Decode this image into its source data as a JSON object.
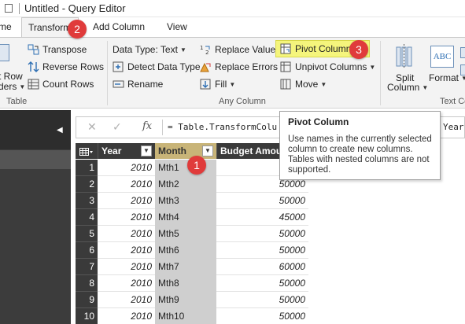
{
  "window": {
    "title": "Untitled - Query Editor"
  },
  "tabs": [
    {
      "label": "me"
    },
    {
      "label": "Transform"
    },
    {
      "label": "Add Column"
    },
    {
      "label": "View"
    }
  ],
  "ribbon": {
    "table_group": {
      "row_line1": "t Row",
      "row_line2": "ders",
      "transpose": "Transpose",
      "reverse_rows": "Reverse Rows",
      "count_rows": "Count Rows",
      "label": "Table"
    },
    "any_column_group": {
      "data_type": "Data Type: Text",
      "detect_data_type": "Detect Data Type",
      "rename": "Rename",
      "replace_values": "Replace Values",
      "replace_errors": "Replace Errors",
      "fill": "Fill",
      "pivot_column": "Pivot Column",
      "unpivot_columns": "Unpivot Columns",
      "move": "Move",
      "label": "Any Column"
    },
    "text_column_group": {
      "split_line1": "Split",
      "split_line2": "Column",
      "format": "Format",
      "abc_icon": "ABC",
      "label": "Text Co"
    }
  },
  "formula_bar": {
    "cancel": "✕",
    "confirm": "✓",
    "fx": "fx",
    "formula": "= Table.TransformColu",
    "formula_tail": "Year\""
  },
  "grid": {
    "columns": [
      "Year",
      "Month",
      "Budget Amount"
    ],
    "rows": [
      {
        "idx": "1",
        "year": "2010",
        "month": "Mth1",
        "amt": ""
      },
      {
        "idx": "2",
        "year": "2010",
        "month": "Mth2",
        "amt": "50000"
      },
      {
        "idx": "3",
        "year": "2010",
        "month": "Mth3",
        "amt": "50000"
      },
      {
        "idx": "4",
        "year": "2010",
        "month": "Mth4",
        "amt": "45000"
      },
      {
        "idx": "5",
        "year": "2010",
        "month": "Mth5",
        "amt": "50000"
      },
      {
        "idx": "6",
        "year": "2010",
        "month": "Mth6",
        "amt": "50000"
      },
      {
        "idx": "7",
        "year": "2010",
        "month": "Mth7",
        "amt": "60000"
      },
      {
        "idx": "8",
        "year": "2010",
        "month": "Mth8",
        "amt": "50000"
      },
      {
        "idx": "9",
        "year": "2010",
        "month": "Mth9",
        "amt": "50000"
      },
      {
        "idx": "10",
        "year": "2010",
        "month": "Mth10",
        "amt": "50000"
      }
    ]
  },
  "tooltip": {
    "title": "Pivot Column",
    "body": "Use names in the currently selected\ncolumn to create new columns.\nTables with nested columns are not\nsupported."
  },
  "callouts": [
    "1",
    "2",
    "3"
  ],
  "colors": {
    "callout": "#e03b3b",
    "highlight": "#f5f57c",
    "dark_panel": "#3a3a3a"
  }
}
